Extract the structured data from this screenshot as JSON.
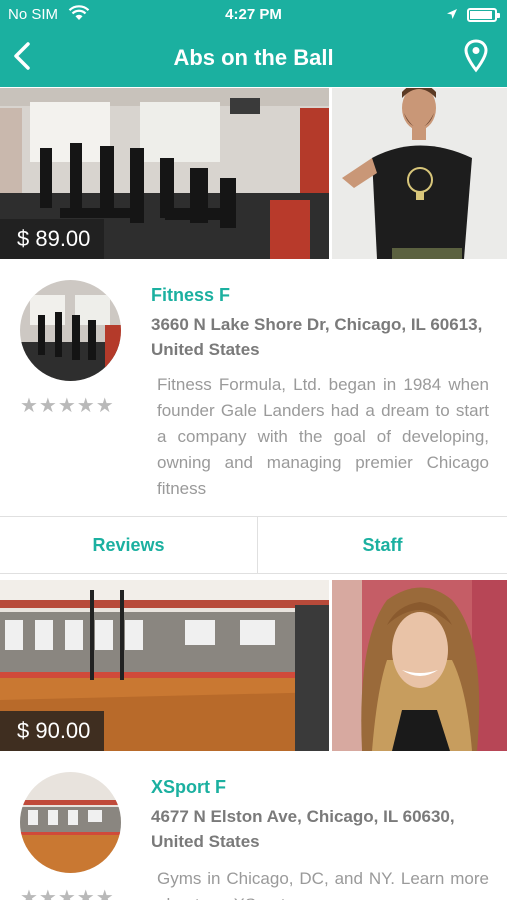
{
  "status_bar": {
    "carrier": "No SIM",
    "time": "4:27 PM"
  },
  "nav": {
    "title": "Abs on the Ball",
    "back_icon": "chevron-left-icon",
    "map_icon": "map-pin-icon"
  },
  "colors": {
    "brand": "#1bb0a0",
    "text_gray": "#7a7a7a",
    "star_gray": "#b9b9b9"
  },
  "listings": [
    {
      "price": "$ 89.00",
      "name": "Fitness F",
      "address": "3660 N Lake Shore Dr, Chicago, IL 60613, United States",
      "description": "Fitness Formula, Ltd. began in 1984 when founder Gale Landers had a dream to start a company with the goal of developing, owning and managing premier Chicago fitness",
      "rating_stars": "★★★★★",
      "rating": 0
    },
    {
      "price": "$ 90.00",
      "name": "XSport F",
      "address": "4677 N Elston Ave, Chicago, IL 60630, United States",
      "description": "Gyms in Chicago, DC, and NY. Learn more about our XSport",
      "rating_stars": "★★★★★",
      "rating": 0
    }
  ],
  "tabs": {
    "reviews": "Reviews",
    "staff": "Staff"
  }
}
